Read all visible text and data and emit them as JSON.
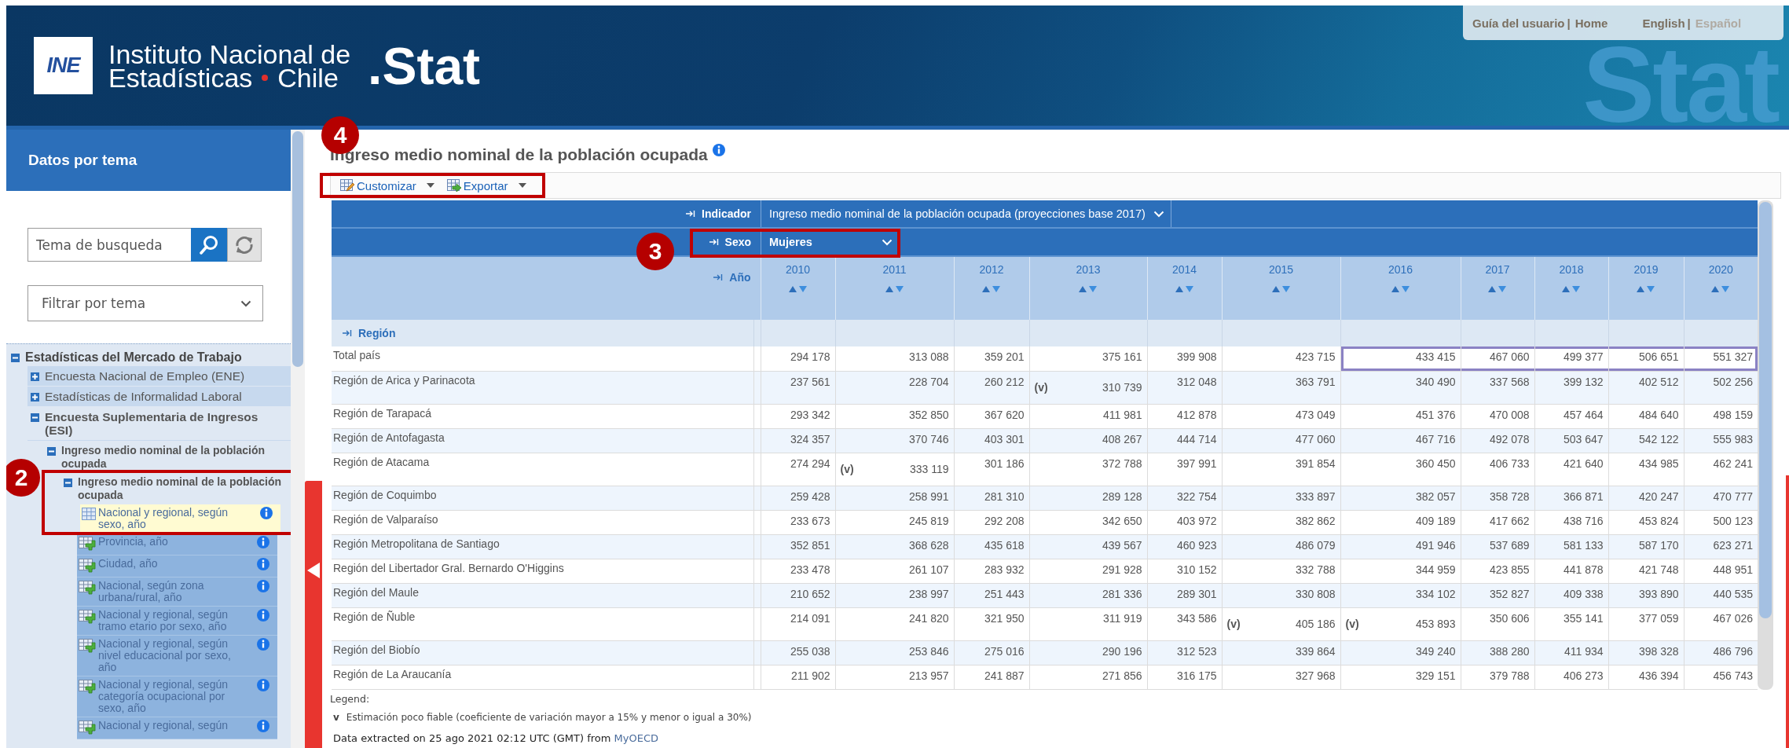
{
  "header": {
    "logo_mark": "INE",
    "org_line1": "Instituto Nacional de",
    "org_line2_word": "Estadísticas",
    "country": "Chile",
    "product": ".Stat",
    "art_text": "Stat",
    "links": [
      {
        "label": "Guía del usuario"
      },
      {
        "label": "Home"
      }
    ],
    "links_separator": "|",
    "languages": [
      {
        "label": "English",
        "selected": false
      },
      {
        "label": "Español",
        "selected": true
      }
    ],
    "languages_separator": "|"
  },
  "sidebar": {
    "title": "Datos por tema",
    "search": {
      "placeholder": "Tema de busqueda"
    },
    "filter": {
      "value": "Filtrar por tema"
    },
    "tree": [
      {
        "kind": "folder",
        "label": "Estadísticas del Mercado de Trabajo",
        "expanded": true,
        "children": [
          {
            "kind": "folder",
            "label": "Encuesta Nacional de Empleo (ENE)",
            "expanded": false
          },
          {
            "kind": "folder",
            "label": "Estadísticas de Informalidad Laboral",
            "expanded": false
          },
          {
            "kind": "folder",
            "label": "Encuesta Suplementaria de Ingresos (ESI)",
            "expanded": true,
            "children": [
              {
                "kind": "folder",
                "label": "Ingreso medio nominal de la población ocupada",
                "expanded": true,
                "children": [
                  {
                    "kind": "folder",
                    "label": "Ingreso medio nominal de la población ocupada",
                    "expanded": true,
                    "callout": "2",
                    "children": [
                      {
                        "kind": "dataset",
                        "label": "Nacional y regional, según sexo, año",
                        "selected": true
                      },
                      {
                        "kind": "dataset",
                        "label": "Provincia, año",
                        "selected": false
                      },
                      {
                        "kind": "dataset",
                        "label": "Ciudad, año",
                        "selected": false
                      },
                      {
                        "kind": "dataset",
                        "label": "Nacional, según zona urbana/rural, año",
                        "selected": false
                      },
                      {
                        "kind": "dataset",
                        "label": "Nacional y regional, según tramo etario por sexo, año",
                        "selected": false
                      },
                      {
                        "kind": "dataset",
                        "label": "Nacional y regional, según nivel educacional por sexo, año",
                        "selected": false
                      },
                      {
                        "kind": "dataset",
                        "label": "Nacional y regional, según categoría ocupacional por sexo, año",
                        "selected": false
                      },
                      {
                        "kind": "dataset",
                        "label": "Nacional y regional, según",
                        "selected": false
                      }
                    ]
                  }
                ]
              }
            ]
          }
        ]
      }
    ]
  },
  "main": {
    "title": "Ingreso medio nominal de la población ocupada",
    "toolbar": {
      "callout": "4",
      "items": [
        {
          "kind": "customize",
          "label": "Customizar"
        },
        {
          "kind": "export",
          "label": "Exportar"
        }
      ]
    },
    "table": {
      "indicator": {
        "label": "Indicador",
        "value": "Ingreso medio nominal de la población ocupada (proyecciones base 2017)"
      },
      "sex": {
        "label": "Sexo",
        "value": "Mujeres",
        "callout": "3"
      },
      "year_label": "Año",
      "years": [
        "2010",
        "2011",
        "2012",
        "2013",
        "2014",
        "2015",
        "2016",
        "2017",
        "2018",
        "2019",
        "2020"
      ],
      "row_header": "Región",
      "rows": [
        {
          "label": "Total país",
          "cells": [
            {
              "value": "294 178",
              "highlighted": false
            },
            {
              "value": "313 088",
              "highlighted": false
            },
            {
              "value": "359 201",
              "highlighted": false
            },
            {
              "value": "375 161",
              "highlighted": false
            },
            {
              "value": "399 908",
              "highlighted": false
            },
            {
              "value": "423 715",
              "highlighted": false
            },
            {
              "value": "433 415",
              "highlighted": true
            },
            {
              "value": "467 060",
              "highlighted": true
            },
            {
              "value": "499 377",
              "highlighted": true
            },
            {
              "value": "506 651",
              "highlighted": true
            },
            {
              "value": "551 327",
              "highlighted": true
            }
          ]
        },
        {
          "label": "Región de Arica y Parinacota",
          "cells": [
            {
              "value": "237 561"
            },
            {
              "value": "228 704"
            },
            {
              "value": "260 212"
            },
            {
              "value": "310 739",
              "flag": "(v)"
            },
            {
              "value": "312 048"
            },
            {
              "value": "363 791"
            },
            {
              "value": "340 490"
            },
            {
              "value": "337 568"
            },
            {
              "value": "399 132"
            },
            {
              "value": "402 512"
            },
            {
              "value": "502 256"
            }
          ]
        },
        {
          "label": "Región de Tarapacá",
          "cells": [
            {
              "value": "293 342"
            },
            {
              "value": "352 850"
            },
            {
              "value": "367 620"
            },
            {
              "value": "411 981"
            },
            {
              "value": "412 878"
            },
            {
              "value": "473 049"
            },
            {
              "value": "451 376"
            },
            {
              "value": "470 008"
            },
            {
              "value": "457 464"
            },
            {
              "value": "484 640"
            },
            {
              "value": "498 159"
            }
          ]
        },
        {
          "label": "Región de Antofagasta",
          "cells": [
            {
              "value": "324 357"
            },
            {
              "value": "370 746"
            },
            {
              "value": "403 301"
            },
            {
              "value": "408 267"
            },
            {
              "value": "444 714"
            },
            {
              "value": "477 060"
            },
            {
              "value": "467 716"
            },
            {
              "value": "492 078"
            },
            {
              "value": "503 647"
            },
            {
              "value": "542 122"
            },
            {
              "value": "555 983"
            }
          ]
        },
        {
          "label": "Región de Atacama",
          "cells": [
            {
              "value": "274 294"
            },
            {
              "value": "333 119",
              "flag": "(v)"
            },
            {
              "value": "301 186"
            },
            {
              "value": "372 788"
            },
            {
              "value": "397 991"
            },
            {
              "value": "391 854"
            },
            {
              "value": "360 450"
            },
            {
              "value": "406 733"
            },
            {
              "value": "421 640"
            },
            {
              "value": "434 985"
            },
            {
              "value": "462 241"
            }
          ]
        },
        {
          "label": "Región de Coquimbo",
          "cells": [
            {
              "value": "259 428"
            },
            {
              "value": "258 991"
            },
            {
              "value": "281 310"
            },
            {
              "value": "289 128"
            },
            {
              "value": "322 754"
            },
            {
              "value": "333 897"
            },
            {
              "value": "382 057"
            },
            {
              "value": "358 728"
            },
            {
              "value": "366 871"
            },
            {
              "value": "420 247"
            },
            {
              "value": "470 777"
            }
          ]
        },
        {
          "label": "Región de Valparaíso",
          "cells": [
            {
              "value": "233 673"
            },
            {
              "value": "245 819"
            },
            {
              "value": "292 208"
            },
            {
              "value": "342 650"
            },
            {
              "value": "403 972"
            },
            {
              "value": "382 862"
            },
            {
              "value": "409 189"
            },
            {
              "value": "417 662"
            },
            {
              "value": "438 716"
            },
            {
              "value": "453 824"
            },
            {
              "value": "500 123"
            }
          ]
        },
        {
          "label": "Región Metropolitana de Santiago",
          "cells": [
            {
              "value": "352 851"
            },
            {
              "value": "368 628"
            },
            {
              "value": "435 618"
            },
            {
              "value": "439 567"
            },
            {
              "value": "460 923"
            },
            {
              "value": "486 079"
            },
            {
              "value": "491 946"
            },
            {
              "value": "537 689"
            },
            {
              "value": "581 133"
            },
            {
              "value": "587 170"
            },
            {
              "value": "623 271"
            }
          ]
        },
        {
          "label": "Región del Libertador Gral. Bernardo O'Higgins",
          "cells": [
            {
              "value": "233 478"
            },
            {
              "value": "261 107"
            },
            {
              "value": "283 932"
            },
            {
              "value": "291 928"
            },
            {
              "value": "310 152"
            },
            {
              "value": "332 788"
            },
            {
              "value": "344 959"
            },
            {
              "value": "423 855"
            },
            {
              "value": "441 878"
            },
            {
              "value": "421 748"
            },
            {
              "value": "448 951"
            }
          ]
        },
        {
          "label": "Región del Maule",
          "cells": [
            {
              "value": "210 652"
            },
            {
              "value": "238 997"
            },
            {
              "value": "251 443"
            },
            {
              "value": "281 336"
            },
            {
              "value": "289 301"
            },
            {
              "value": "330 808"
            },
            {
              "value": "334 102"
            },
            {
              "value": "352 827"
            },
            {
              "value": "409 338"
            },
            {
              "value": "393 890"
            },
            {
              "value": "440 535"
            }
          ]
        },
        {
          "label": "Región de Ñuble",
          "cells": [
            {
              "value": "214 091"
            },
            {
              "value": "241 820"
            },
            {
              "value": "321 950"
            },
            {
              "value": "311 919"
            },
            {
              "value": "343 586"
            },
            {
              "value": "405 186",
              "flag": "(v)"
            },
            {
              "value": "453 893",
              "flag": "(v)"
            },
            {
              "value": "350 606"
            },
            {
              "value": "355 141"
            },
            {
              "value": "377 059"
            },
            {
              "value": "467 026"
            }
          ]
        },
        {
          "label": "Región del Biobío",
          "cells": [
            {
              "value": "255 038"
            },
            {
              "value": "253 846"
            },
            {
              "value": "275 016"
            },
            {
              "value": "290 196"
            },
            {
              "value": "312 523"
            },
            {
              "value": "339 864"
            },
            {
              "value": "349 240"
            },
            {
              "value": "388 280"
            },
            {
              "value": "411 934"
            },
            {
              "value": "398 328"
            },
            {
              "value": "486 796"
            }
          ]
        },
        {
          "label": "Región de La Araucanía",
          "cells": [
            {
              "value": "211 902"
            },
            {
              "value": "213 957"
            },
            {
              "value": "241 887"
            },
            {
              "value": "271 856"
            },
            {
              "value": "316 175"
            },
            {
              "value": "327 968"
            },
            {
              "value": "329 151"
            },
            {
              "value": "379 788"
            },
            {
              "value": "406 273"
            },
            {
              "value": "436 394"
            },
            {
              "value": "456 743"
            }
          ]
        }
      ]
    },
    "legend": {
      "title": "Legend:",
      "items": [
        {
          "code": "v",
          "text": "Estimación poco fiable (coeficiente de variación mayor a 15% y menor o igual a 30%)"
        }
      ]
    },
    "extraction": {
      "text": "Data extracted on 25 ago 2021 02:12 UTC (GMT) from",
      "link": "MyOECD"
    }
  }
}
